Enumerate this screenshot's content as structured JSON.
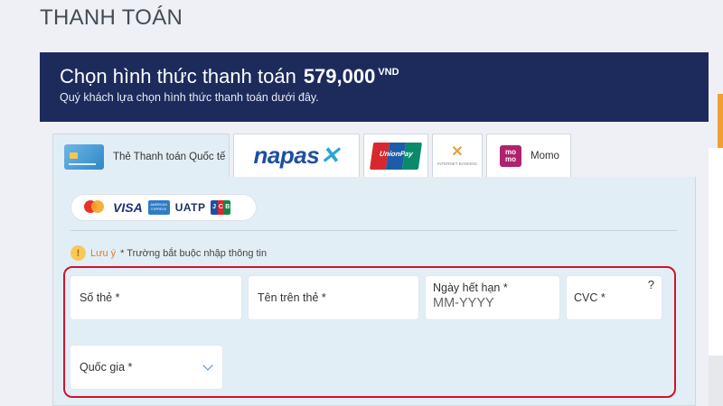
{
  "page": {
    "title": "THANH TOÁN"
  },
  "banner": {
    "title": "Chọn hình thức thanh toán",
    "amount": "579,000",
    "currency": "VND",
    "subtitle": "Quý khách lựa chọn hình thức thanh toán dưới đây."
  },
  "tabs": {
    "international": {
      "label": "Thẻ Thanh toán Quốc tế"
    },
    "napas": {
      "logo_text": "napas"
    },
    "unionpay": {
      "logo_text": "UnionPay"
    },
    "inet": {
      "logo_text": "INTERNET BANKING"
    },
    "momo": {
      "label": "Momo",
      "logo_text": "mo mo"
    }
  },
  "card_brands": {
    "visa": "VISA",
    "amex": "AMERICAN EXPRESS",
    "uatp": "UATP",
    "jcb": [
      "J",
      "C",
      "B"
    ]
  },
  "note": {
    "label": "Lưu ý",
    "text": "* Trường bắt buộc nhập thông tin"
  },
  "form": {
    "card_number": "Số thẻ *",
    "card_name": "Tên trên thẻ *",
    "expiry_label": "Ngày hết hạn *",
    "expiry_placeholder": "MM-YYYY",
    "cvc": "CVC *",
    "cvc_help": "?",
    "country": "Quốc gia *"
  },
  "colors": {
    "banner_bg": "#1d2b5c",
    "panel_bg": "#e2eef6",
    "error_border": "#d2122b",
    "note_orange": "#e07b22"
  },
  "icons": [
    "credit-card-icon",
    "warning-icon",
    "help-icon",
    "chevron-down-icon"
  ]
}
